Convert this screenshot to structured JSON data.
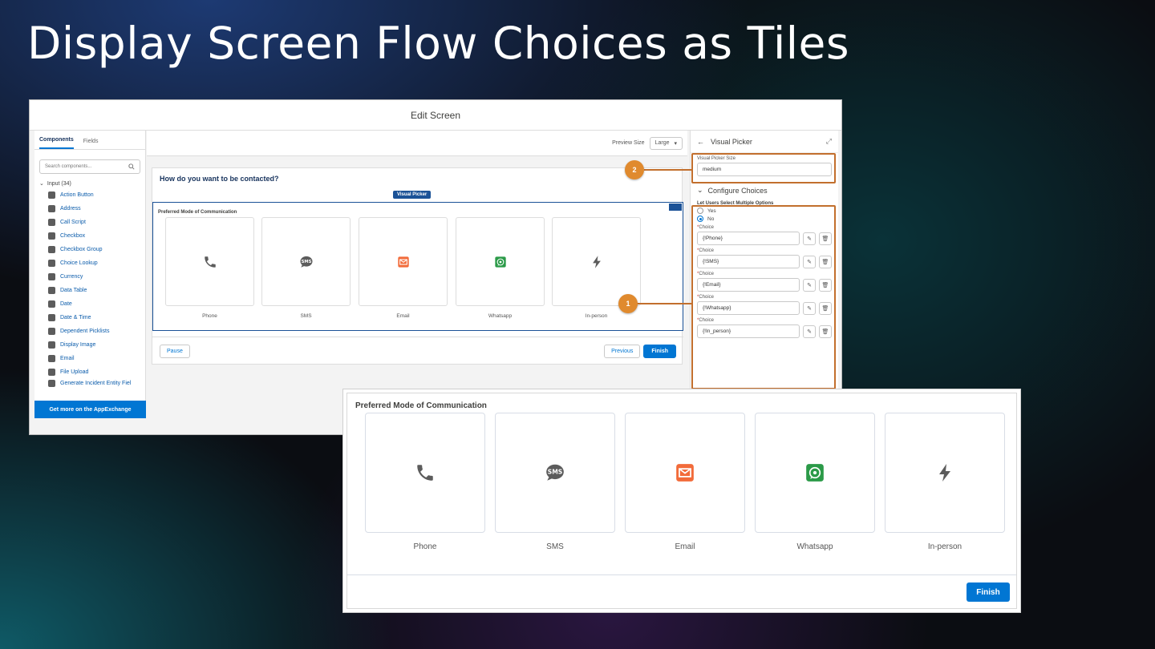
{
  "slide": {
    "title": "Display Screen Flow Choices as Tiles"
  },
  "editor": {
    "header_title": "Edit Screen",
    "left_panel": {
      "tabs": [
        "Components",
        "Fields"
      ],
      "search_placeholder": "Search components...",
      "group_label": "Input (34)",
      "components": [
        "Action Button",
        "Address",
        "Call Script",
        "Checkbox",
        "Checkbox Group",
        "Choice Lookup",
        "Currency",
        "Data Table",
        "Date",
        "Date & Time",
        "Dependent Picklists",
        "Display Image",
        "Email",
        "File Upload",
        "Generate Incident Entity Fiel"
      ],
      "appexchange_label": "Get more on the AppExchange"
    },
    "toolbar": {
      "preview_size_label": "Preview Size",
      "preview_size_value": "Large"
    },
    "canvas": {
      "question": "How do you want to be contacted?",
      "component_badge": "Visual Picker",
      "picker_label": "Preferred Mode of Communication",
      "tiles": [
        {
          "label": "Phone",
          "icon": "phone-icon"
        },
        {
          "label": "SMS",
          "icon": "sms-icon"
        },
        {
          "label": "Email",
          "icon": "email-icon"
        },
        {
          "label": "Whatsapp",
          "icon": "whatsapp-icon"
        },
        {
          "label": "In-person",
          "icon": "lightning-icon"
        }
      ],
      "pause_label": "Pause",
      "previous_label": "Previous",
      "finish_label": "Finish"
    },
    "right_panel": {
      "back_title": "Visual Picker",
      "size_label": "Visual Picker Size",
      "size_value": "medium",
      "configure_label": "Configure Choices",
      "multi_label": "Let Users Select Multiple Options",
      "multi_yes": "Yes",
      "multi_no": "No",
      "choice_label": "Choice",
      "choices": [
        "{!Phone}",
        "{!SMS}",
        "{!Email}",
        "{!Whatsapp}",
        "{!In_person}"
      ]
    },
    "markers": [
      "1",
      "2"
    ]
  },
  "preview": {
    "picker_label": "Preferred Mode of Communication",
    "tiles": [
      {
        "label": "Phone",
        "icon": "phone-icon"
      },
      {
        "label": "SMS",
        "icon": "sms-icon"
      },
      {
        "label": "Email",
        "icon": "email-icon"
      },
      {
        "label": "Whatsapp",
        "icon": "whatsapp-icon"
      },
      {
        "label": "In-person",
        "icon": "lightning-icon"
      }
    ],
    "finish_label": "Finish"
  },
  "colors": {
    "brand_blue": "#0176d3",
    "picker_blue": "#1b5297",
    "callout_orange": "#c26f2d",
    "marker_orange": "#e08a2e",
    "email_orange": "#f26b3a",
    "whatsapp_green": "#2b9a48",
    "icon_gray": "#5c5c5c"
  }
}
